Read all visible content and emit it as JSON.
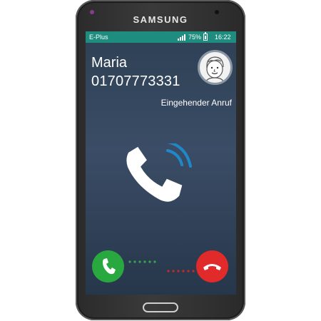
{
  "device": {
    "brand": "SAMSUNG"
  },
  "statusbar": {
    "carrier": "E-Plus",
    "battery": "75%",
    "time": "16:22"
  },
  "call": {
    "caller_name": "Maria",
    "caller_number": "01707773331",
    "status": "Eingehender Anruf"
  },
  "icons": {
    "signal": "signal-strength-icon",
    "battery": "battery-icon",
    "avatar": "person-avatar-icon",
    "ringing": "ringing-phone-icon",
    "accept": "phone-icon",
    "reject": "hang-up-icon"
  },
  "colors": {
    "statusbar": "#1e8c7e",
    "accept": "#2aa840",
    "reject": "#e12a2a",
    "ring_waves": "#1e88c8",
    "screen": "#34465c"
  }
}
